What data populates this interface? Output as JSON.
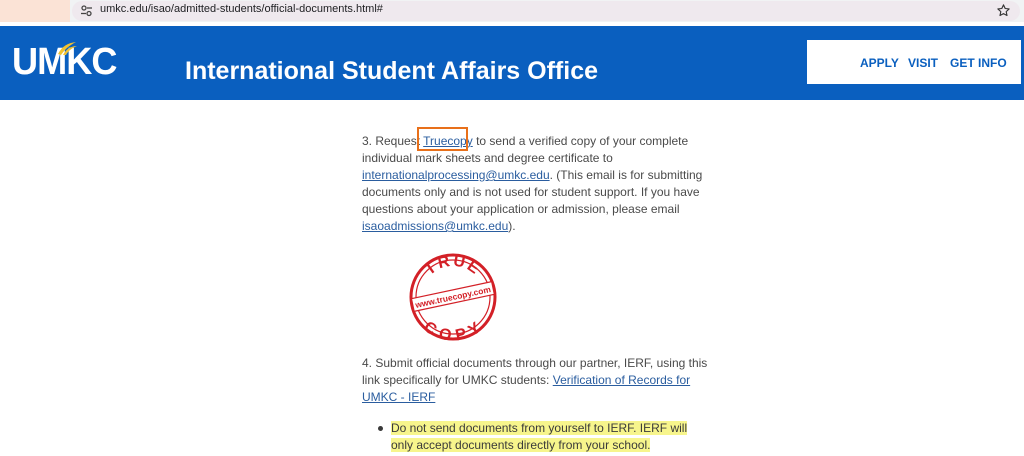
{
  "browser": {
    "url": "umkc.edu/isao/admitted-students/official-documents.html#"
  },
  "header": {
    "logo": "UMKC",
    "title": "International Student Affairs Office",
    "nav": [
      "APPLY",
      "VISIT",
      "GET INFO"
    ]
  },
  "step3": {
    "prefix": "3. Request ",
    "link1": "Truecopy",
    "mid1": " to send a verified copy of your complete individual mark sheets and degree certificate to ",
    "link2": "internationalprocessing@umkc.edu",
    "mid2": ". (This email is for submitting documents only and is not used for student support. If you have questions about your application or admission, please email ",
    "link3": "isaoadmissions@umkc.edu",
    "suffix": ")."
  },
  "seal": {
    "top": "TRUE",
    "middle": "www.truecopy.com",
    "bottom": "COPY"
  },
  "step4": {
    "prefix": "4. Submit official documents through our partner, IERF, using this link specifically for UMKC students: ",
    "link": "Verification of Records for UMKC - IERF"
  },
  "bullets": [
    "Do not send documents from yourself to IERF. IERF will only accept documents directly from your school."
  ],
  "colors": {
    "header_blue": "#0a5fbf",
    "highlight_box": "#e8701a",
    "text_highlight": "#f7f58c",
    "seal_red": "#d32027"
  }
}
